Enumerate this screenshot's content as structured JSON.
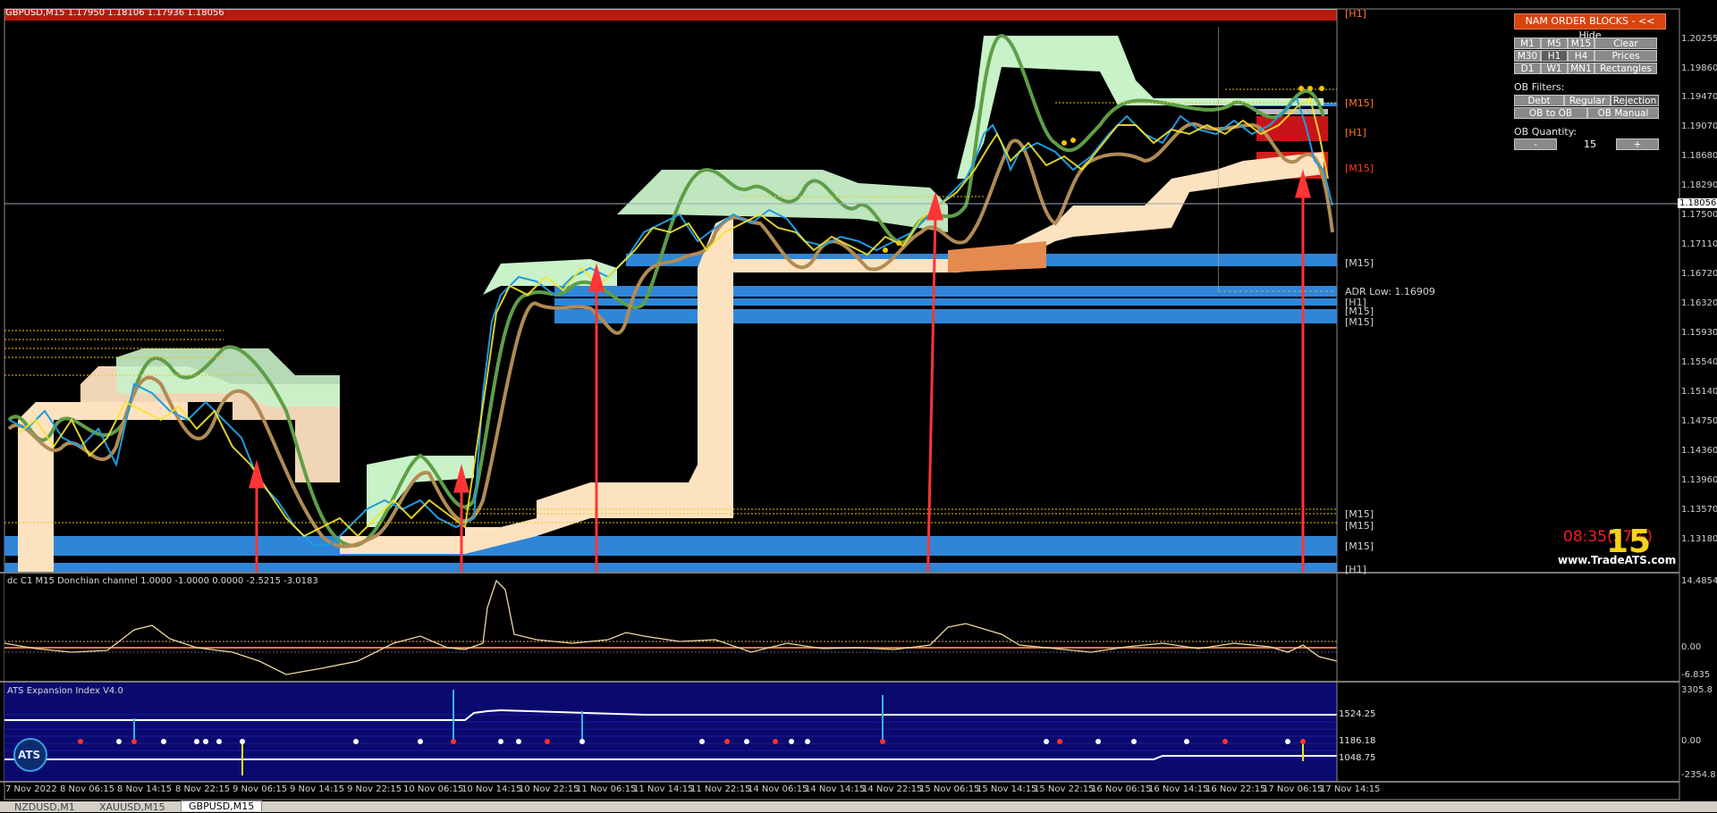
{
  "symbol_label": "GBPUSD,M15  1.17950 1.18106 1.17936 1.18056",
  "price_axis": [
    "1.20255",
    "1.19860",
    "1.19470",
    "1.19070",
    "1.18680",
    "1.18290",
    "1.18056",
    "1.17500",
    "1.17110",
    "1.16720",
    "1.16320",
    "1.15930",
    "1.15540",
    "1.15140",
    "1.14750",
    "1.14360",
    "1.13960",
    "1.13570",
    "1.13180"
  ],
  "current_price": "1.18056",
  "zone_tags": {
    "h1_top": "[H1]",
    "m15_a": "[M15]",
    "h1_b": "[H1]",
    "m15_b": "[M15]",
    "m15_c": "[M15]",
    "h1_c": "[H1]",
    "m15_d": "[M15]",
    "m15_e": "[M15]",
    "m15_f": "[M15]",
    "m15_g": "[M15]",
    "m15_h": "[M15]",
    "h1_bottom": "[H1]"
  },
  "adr_label": "ADR Low: 1.16909",
  "ob_panel": {
    "header": "NAM ORDER BLOCKS - << Hide",
    "tf_row1": [
      "M1",
      "M5",
      "M15",
      "Clear"
    ],
    "tf_row2": [
      "M30",
      "H1",
      "H4",
      "Prices"
    ],
    "tf_row3": [
      "D1",
      "W1",
      "MN1",
      "Rectangles"
    ],
    "filters_label": "OB Filters:",
    "filter_row1": [
      "Debt",
      "Regular",
      "Rejection"
    ],
    "filter_row2": [
      "OB to OB",
      "OB Manual"
    ],
    "quantity_label": "OB Quantity:",
    "quantity_minus": "-",
    "quantity_value": "15",
    "quantity_plus": "+"
  },
  "timer": "08:35(57%)",
  "big_number": "15",
  "website": "www.TradeATS.com",
  "indicator1": {
    "title": "dc C1 M15 Donchian channel 1.0000 -1.0000 0.0000 -2.5215 -3.0183",
    "axis": [
      "14.4854",
      "0.00",
      "-6.835"
    ]
  },
  "indicator2": {
    "title": "ATS Expansion Index V4.0",
    "axis": [
      "3305.8",
      "1524.25",
      "1186.18",
      "0.00",
      "1048.75",
      "-2354.8"
    ],
    "logo": "ATS"
  },
  "time_axis": [
    "7 Nov 2022",
    "8 Nov 06:15",
    "8 Nov 14:15",
    "8 Nov 22:15",
    "9 Nov 06:15",
    "9 Nov 14:15",
    "9 Nov 22:15",
    "10 Nov 06:15",
    "10 Nov 14:15",
    "10 Nov 22:15",
    "11 Nov 06:15",
    "11 Nov 14:15",
    "11 Nov 22:15",
    "14 Nov 06:15",
    "14 Nov 14:15",
    "14 Nov 22:15",
    "15 Nov 06:15",
    "15 Nov 14:15",
    "15 Nov 22:15",
    "16 Nov 06:15",
    "16 Nov 14:15",
    "16 Nov 22:15",
    "17 Nov 06:15",
    "17 Nov 14:15"
  ],
  "tabs": [
    "NZDUSD,M1",
    "XAUUSD,M15",
    "GBPUSD,M15"
  ],
  "colors": {
    "bg": "#000000",
    "buy_arrow": "#ff3535",
    "ob_blue": "#2f86d8",
    "zone_peach": "#fde2c0",
    "zone_green": "#c9f2c9",
    "ma_green": "#5f9e48",
    "ma_tan": "#b08b55"
  }
}
